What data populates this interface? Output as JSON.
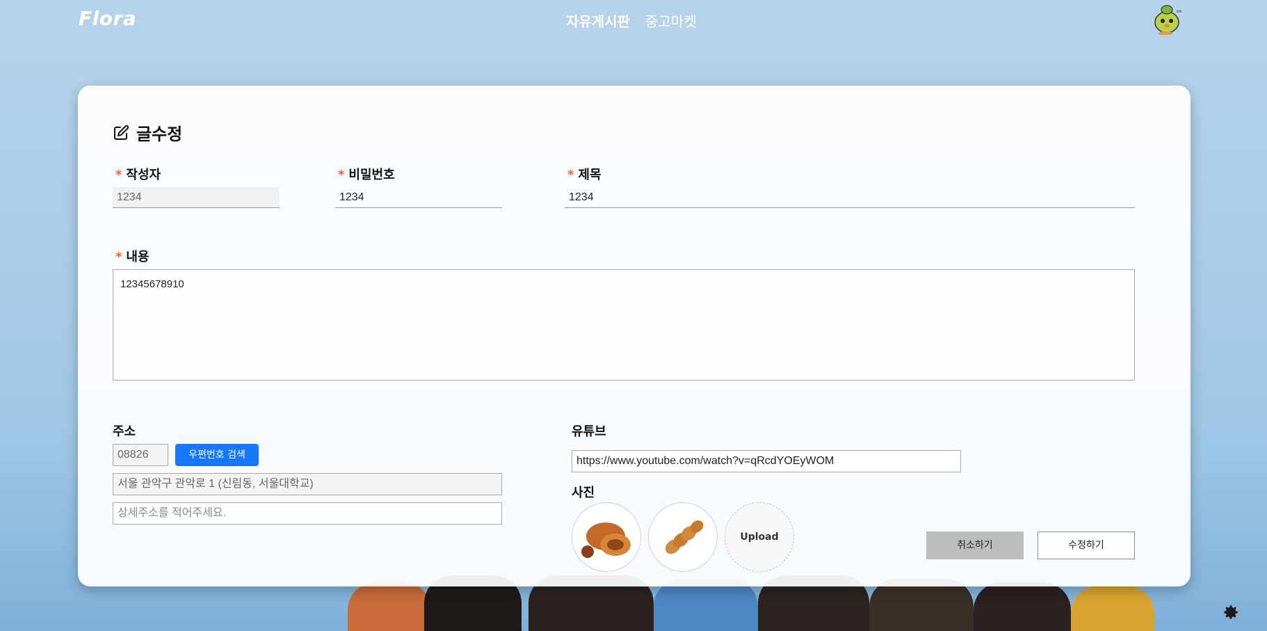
{
  "header": {
    "logo": "Flora",
    "nav": [
      "자유게시판",
      "중고마켓"
    ]
  },
  "form": {
    "title": "글수정",
    "required_mark": "*",
    "writer": {
      "label": "작성자",
      "value": "1234"
    },
    "password": {
      "label": "비밀번호",
      "value": "1234"
    },
    "subject": {
      "label": "제목",
      "value": "1234"
    },
    "contents": {
      "label": "내용",
      "value": "12345678910"
    },
    "address": {
      "label": "주소",
      "zipcode": "08826",
      "search_button": "우편번호 검색",
      "address": "서울 관악구 관악로 1 (신림동, 서울대학교)",
      "detail_placeholder": "상세주소를 적어주세요."
    },
    "youtube": {
      "label": "유튜브",
      "value": "https://www.youtube.com/watch?v=qRcdYOEyWOM"
    },
    "photos": {
      "label": "사진",
      "upload_label": "Upload"
    },
    "buttons": {
      "cancel": "취소하기",
      "submit": "수정하기"
    }
  },
  "colors": {
    "accent": "#1677ff",
    "required": "#ff5a1f"
  }
}
